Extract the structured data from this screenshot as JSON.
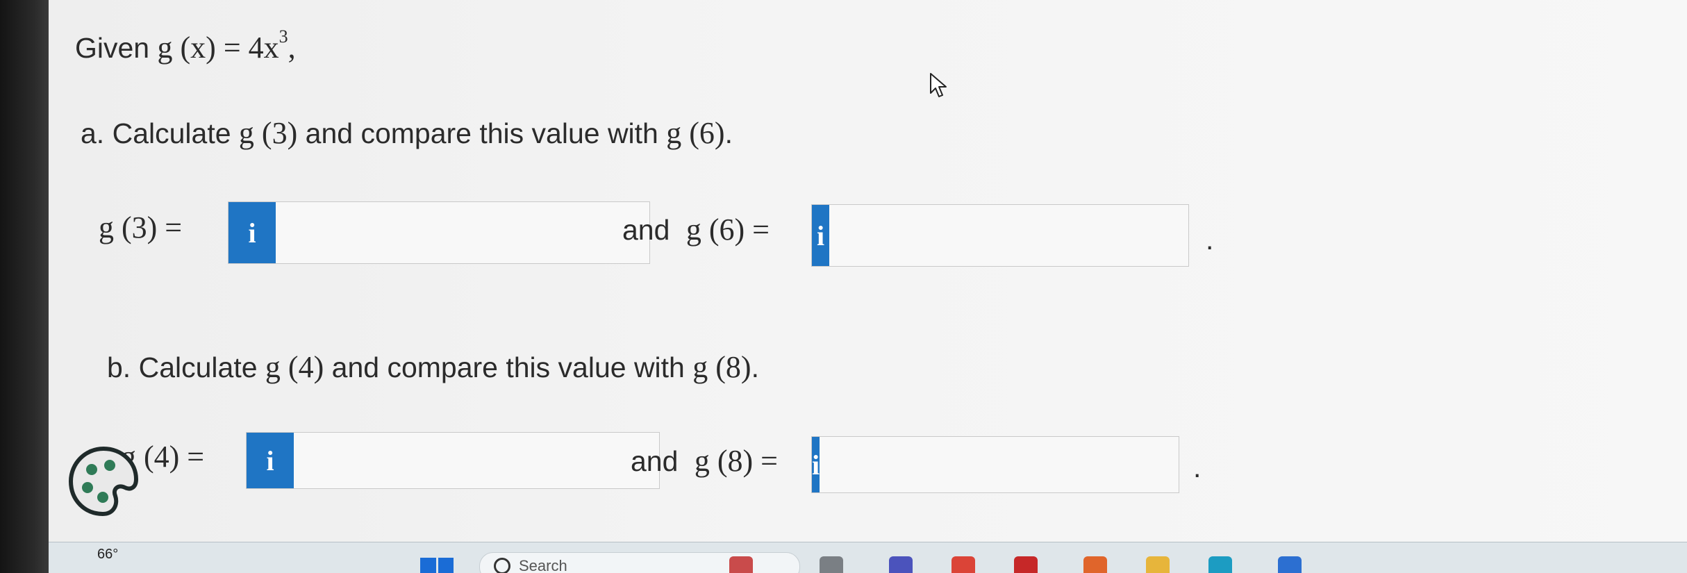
{
  "problem": {
    "intro_label": "Given",
    "intro_math": "g (x)  =  4x",
    "intro_exp": "3",
    "intro_tail": ",",
    "part_a": {
      "prefix": "a. Calculate",
      "g1": "g (3)",
      "middle": "and compare this value with",
      "g2": "g (6)",
      "end": ".",
      "field1_label": "g (3)  =",
      "and_label": "and",
      "field2_label": "g (6)  =",
      "field1_value": "",
      "field2_value": "",
      "trail": "."
    },
    "part_b": {
      "prefix": "b. Calculate",
      "g1": "g (4)",
      "middle": "and compare this value with",
      "g2": "g (8)",
      "end": ".",
      "field1_label": "g (4)  =",
      "and_label": "and",
      "field2_label": "g (8)  =",
      "field1_value": "",
      "field2_value": "",
      "trail": "."
    },
    "info_glyph": "i"
  },
  "taskbar": {
    "temperature": "66°",
    "search_label": "Search",
    "apps": [
      {
        "icon": "paw-icon",
        "color": "#c94b4b"
      },
      {
        "icon": "file-icon",
        "color": "#7a7f84"
      },
      {
        "icon": "teams-icon",
        "color": "#4b53bc"
      },
      {
        "icon": "chrome-icon",
        "color": "#db4437"
      },
      {
        "icon": "mail-icon",
        "color": "#c62828"
      },
      {
        "icon": "paint-icon",
        "color": "#e0652b"
      },
      {
        "icon": "folder-icon",
        "color": "#e7b53b"
      },
      {
        "icon": "edge-icon",
        "color": "#1c9cc2"
      },
      {
        "icon": "store-icon",
        "color": "#2c6fd1"
      }
    ]
  },
  "colors": {
    "info_button": "#1f75c4",
    "page_background": "#f3f3f3",
    "taskbar": "#dfe6ea"
  }
}
